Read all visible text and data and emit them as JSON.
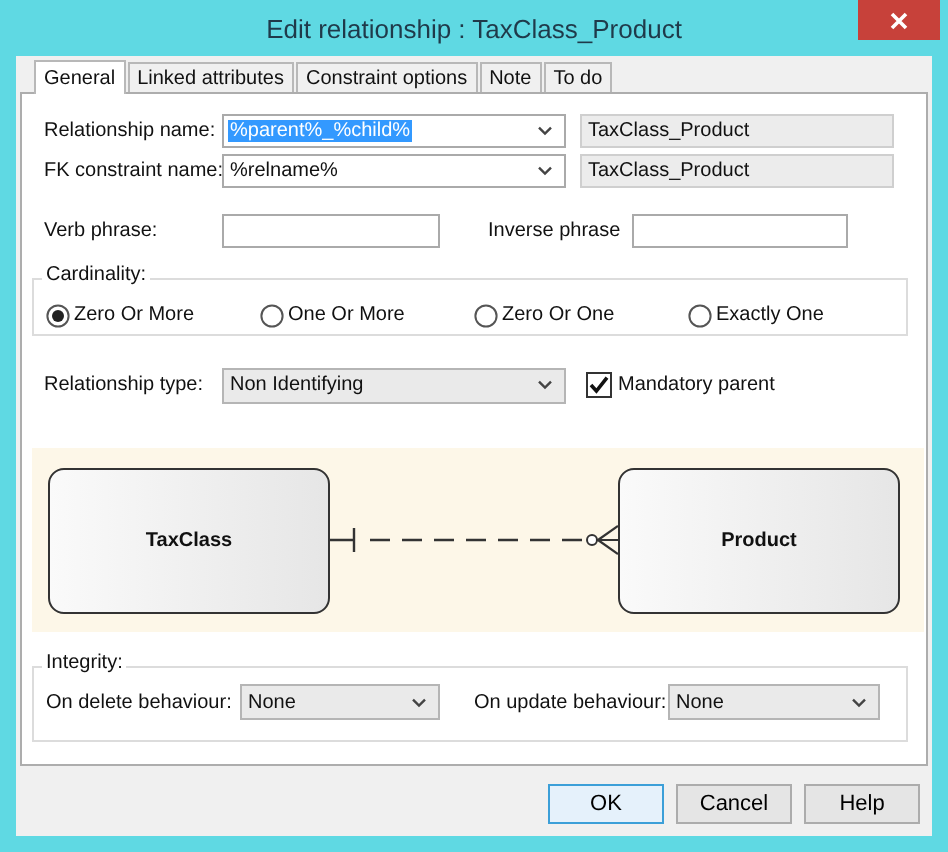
{
  "window": {
    "title": "Edit relationship : TaxClass_Product"
  },
  "tabs": [
    {
      "label": "General",
      "selected": true
    },
    {
      "label": "Linked attributes",
      "selected": false
    },
    {
      "label": "Constraint options",
      "selected": false
    },
    {
      "label": "Note",
      "selected": false
    },
    {
      "label": "To do",
      "selected": false
    }
  ],
  "names": [
    {
      "label": "Relationship name:",
      "value": "%parent%_%child%",
      "highlighted": true,
      "result": "TaxClass_Product"
    },
    {
      "label": "FK constraint name:",
      "value": "%relname%",
      "highlighted": false,
      "result": "TaxClass_Product"
    }
  ],
  "phrases": [
    {
      "label": "Verb phrase:"
    },
    {
      "label": "Inverse phrase"
    }
  ],
  "cardinality": {
    "title": "Cardinality:",
    "options": [
      {
        "label": "Zero Or More",
        "selected": true
      },
      {
        "label": "One Or More",
        "selected": false
      },
      {
        "label": "Zero Or One",
        "selected": false
      },
      {
        "label": "Exactly One",
        "selected": false
      }
    ]
  },
  "relationship_type": {
    "label": "Relationship type:",
    "value": "Non Identifying"
  },
  "mandatory_parent": {
    "label": "Mandatory parent",
    "checked": true
  },
  "diagram": {
    "parent": "TaxClass",
    "child": "Product"
  },
  "integrity": {
    "title": "Integrity:",
    "fields": [
      {
        "label": "On delete behaviour:",
        "value": "None"
      },
      {
        "label": "On update behaviour:",
        "value": "None"
      }
    ]
  },
  "buttons": [
    {
      "label": "OK",
      "default": true
    },
    {
      "label": "Cancel",
      "default": false
    },
    {
      "label": "Help",
      "default": false
    }
  ]
}
